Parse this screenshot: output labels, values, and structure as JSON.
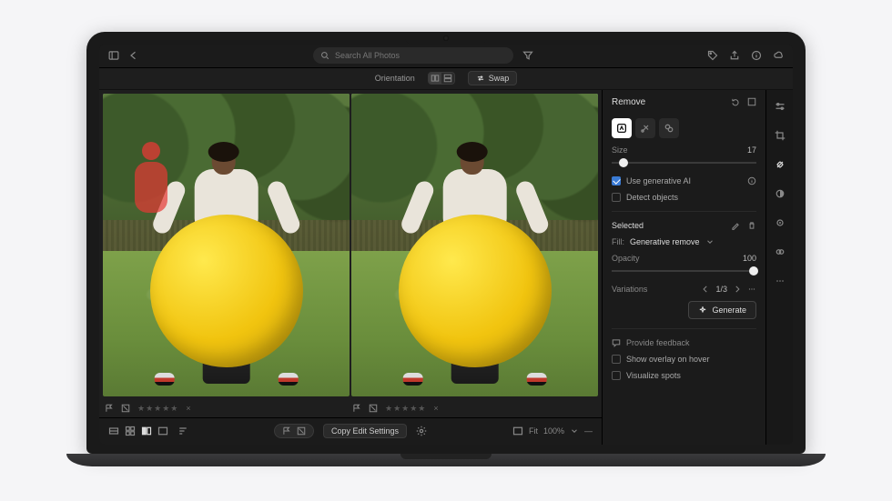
{
  "topbar": {
    "search_placeholder": "Search All Photos"
  },
  "subbar": {
    "orientation_label": "Orientation",
    "swap_label": "Swap"
  },
  "panel": {
    "title": "Remove",
    "size_label": "Size",
    "size_value": "17",
    "use_gen_ai": "Use generative AI",
    "detect_objects": "Detect objects",
    "selected_label": "Selected",
    "fill_prefix": "Fill:",
    "gen_remove": "Generative remove",
    "opacity_label": "Opacity",
    "opacity_value": "100",
    "variations_label": "Variations",
    "variations_value": "1/3",
    "generate_btn": "Generate",
    "feedback": "Provide feedback",
    "show_overlay": "Show overlay on hover",
    "visualize_spots": "Visualize spots"
  },
  "bottombar": {
    "copy_edit": "Copy Edit Settings",
    "fit_label": "Fit",
    "zoom_value": "100%"
  },
  "photo_footer": {
    "stars": "★★★★★",
    "close": "×"
  },
  "colors": {
    "mask": "#e53935",
    "ball": "#f1c40f",
    "accent": "#3a7bd5"
  }
}
